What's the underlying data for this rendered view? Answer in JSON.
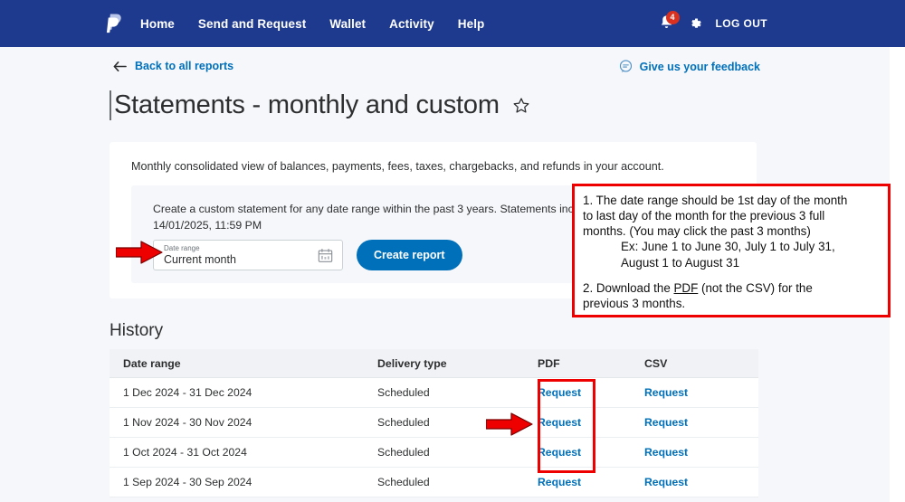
{
  "nav": {
    "logo_name": "paypal-logo",
    "links": [
      {
        "label": "Home"
      },
      {
        "label": "Send and Request"
      },
      {
        "label": "Wallet"
      },
      {
        "label": "Activity"
      },
      {
        "label": "Help"
      }
    ],
    "notification_count": "4",
    "logout_label": "LOG OUT",
    "brand_bg": "#1e3a8f"
  },
  "breadcrumb": {
    "back_label": "Back to all reports",
    "feedback_label": "Give us your feedback",
    "link_color": "#0070ba"
  },
  "header": {
    "title": "Statements - monthly and custom",
    "favorite_icon": "star-outline"
  },
  "card": {
    "description": "Monthly consolidated view of balances, payments, fees, taxes, chargebacks, and refunds in your account.",
    "inner_text_line1": "Create a custom statement for any date range within the past 3 years. Statements include transac",
    "inner_text_line2": "14/01/2025, 11:59 PM",
    "date_range_label": "Date range",
    "date_range_value": "Current month",
    "create_report_label": "Create report",
    "button_color": "#0070ba"
  },
  "callout": {
    "border_color": "#ee0000",
    "line1": "1. The date range should be 1st day of the month",
    "line2": "to last day of the month for the previous 3 full",
    "line3": "months. (You may click the past 3 months)",
    "line4": "Ex: June 1 to June 30, July 1 to July 31,",
    "line5": "August 1 to August 31",
    "line6_prefix": "2. Download the ",
    "line6_underlined": "PDF",
    "line6_suffix": " (not the CSV) for the",
    "line7": "previous 3 months."
  },
  "history": {
    "title": "History",
    "columns": [
      "Date range",
      "Delivery type",
      "PDF",
      "CSV"
    ],
    "rows": [
      {
        "date_range": "1 Dec 2024 - 31 Dec 2024",
        "delivery_type": "Scheduled",
        "pdf": "Request",
        "csv": "Request"
      },
      {
        "date_range": "1 Nov 2024 - 30 Nov 2024",
        "delivery_type": "Scheduled",
        "pdf": "Request",
        "csv": "Request"
      },
      {
        "date_range": "1 Oct 2024 - 31 Oct 2024",
        "delivery_type": "Scheduled",
        "pdf": "Request",
        "csv": "Request"
      },
      {
        "date_range": "1 Sep 2024 - 30 Sep 2024",
        "delivery_type": "Scheduled",
        "pdf": "Request",
        "csv": "Request"
      }
    ]
  },
  "annotations": {
    "arrow_1_name": "red-arrow-to-date-range",
    "arrow_2_name": "red-arrow-to-pdf-request",
    "arrow_color": "#ee0000"
  }
}
